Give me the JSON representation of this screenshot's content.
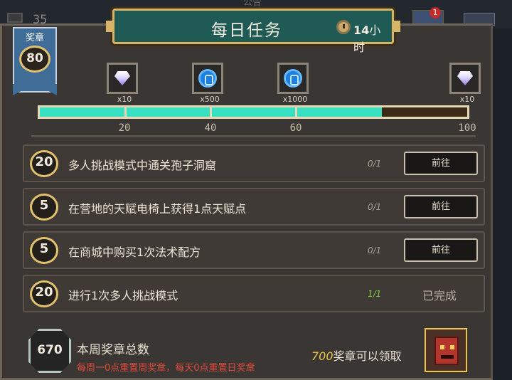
{
  "background": {
    "top_number": "35",
    "top_center_text": "公告",
    "notification_count": "1"
  },
  "header": {
    "title": "每日任务",
    "timer_value": "14",
    "timer_unit": "小时",
    "timer_icon": "clock-icon"
  },
  "medal_ribbon": {
    "label": "奖章",
    "value": "80"
  },
  "rewards": [
    {
      "icon": "diamond-icon",
      "qty": "x10"
    },
    {
      "icon": "blue-coin-icon",
      "qty": "x500"
    },
    {
      "icon": "blue-coin-icon",
      "qty": "x1000"
    },
    {
      "icon": "diamond-icon",
      "qty": "x10"
    }
  ],
  "progress": {
    "current": 80,
    "max": 100,
    "milestones": [
      "20",
      "40",
      "60",
      "100"
    ]
  },
  "tasks": [
    {
      "points": "20",
      "text": "多人挑战模式中通关孢子洞窟",
      "progress": "0/1",
      "action": "前往",
      "completed": false
    },
    {
      "points": "5",
      "text": "在营地的天赋电椅上获得1点天赋点",
      "progress": "0/1",
      "action": "前往",
      "completed": false
    },
    {
      "points": "5",
      "text": "在商城中购买1次法术配方",
      "progress": "0/1",
      "action": "前往",
      "completed": false
    },
    {
      "points": "20",
      "text": "进行1次多人挑战模式",
      "progress": "1/1",
      "action": "已完成",
      "completed": true
    }
  ],
  "footer": {
    "weekly_total": "670",
    "weekly_label": "本周奖章总数",
    "reset_note": "每周一0点重置周奖章，每天0点重置日奖章",
    "claim_number": "700",
    "claim_text": "奖章可以领取",
    "chest_icon": "demon-chest-icon"
  },
  "colors": {
    "banner": "#1f5a55",
    "gold": "#e3c26e",
    "progress_fill": "#37e0c0",
    "warning": "#e14b3d",
    "done": "#7fcf3d"
  }
}
